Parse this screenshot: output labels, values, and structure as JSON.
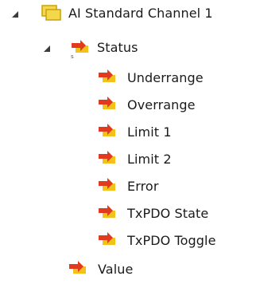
{
  "tree": {
    "root": {
      "label": "AI Standard Channel 1",
      "expanded": true,
      "icon": "channel-folder-icon",
      "children": {
        "status": {
          "label": "Status",
          "expanded": true,
          "icon": "status-variable-icon",
          "items": [
            {
              "label": "Underrange",
              "icon": "input-variable-icon"
            },
            {
              "label": "Overrange",
              "icon": "input-variable-icon"
            },
            {
              "label": "Limit 1",
              "icon": "input-variable-icon"
            },
            {
              "label": "Limit 2",
              "icon": "input-variable-icon"
            },
            {
              "label": "Error",
              "icon": "input-variable-icon"
            },
            {
              "label": "TxPDO State",
              "icon": "input-variable-icon"
            },
            {
              "label": "TxPDO Toggle",
              "icon": "input-variable-icon"
            }
          ]
        },
        "value": {
          "label": "Value",
          "icon": "input-variable-icon"
        }
      }
    }
  },
  "colors": {
    "folder_fill": "#f5d84a",
    "folder_border": "#c9a10f",
    "variable_red": "#e23a1e",
    "variable_yellow": "#f2c21b",
    "toggle": "#3c3c3c"
  }
}
